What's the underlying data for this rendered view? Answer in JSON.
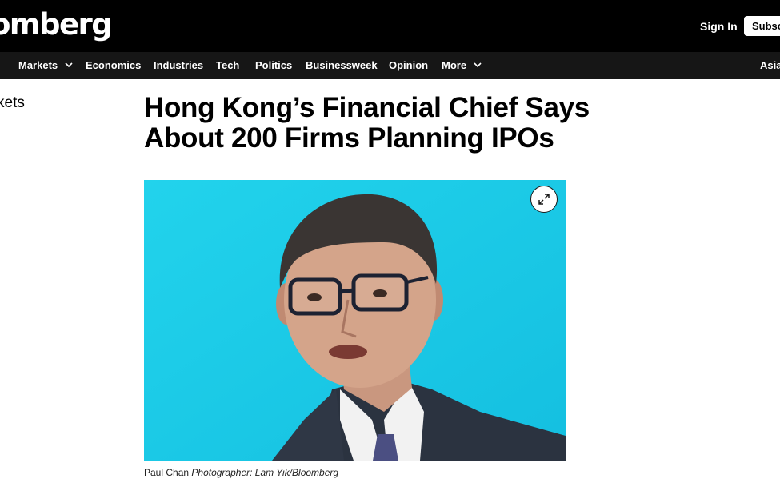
{
  "header": {
    "logo_text": "omberg",
    "sign_in_label": "Sign In",
    "subscribe_label": "Subscribe"
  },
  "nav": {
    "items": [
      {
        "label": "Markets",
        "has_dropdown": true
      },
      {
        "label": "Economics"
      },
      {
        "label": "Industries"
      },
      {
        "label": "Tech"
      },
      {
        "label": "Politics"
      },
      {
        "label": "Businessweek"
      },
      {
        "label": "Opinion"
      },
      {
        "label": "More",
        "has_dropdown": true
      },
      {
        "label": "Asia"
      }
    ]
  },
  "section_label": "kets",
  "article": {
    "headline": "Hong Kong’s Financial Chief Says About 200 Firms Planning IPOs",
    "image": {
      "subject": "man with glasses in suit speaking",
      "background_color": "#1fcfe8",
      "expand_icon": "expand-arrows-icon"
    },
    "caption_name": "Paul Chan",
    "caption_credit": "Photographer: Lam Yik/Bloomberg"
  }
}
